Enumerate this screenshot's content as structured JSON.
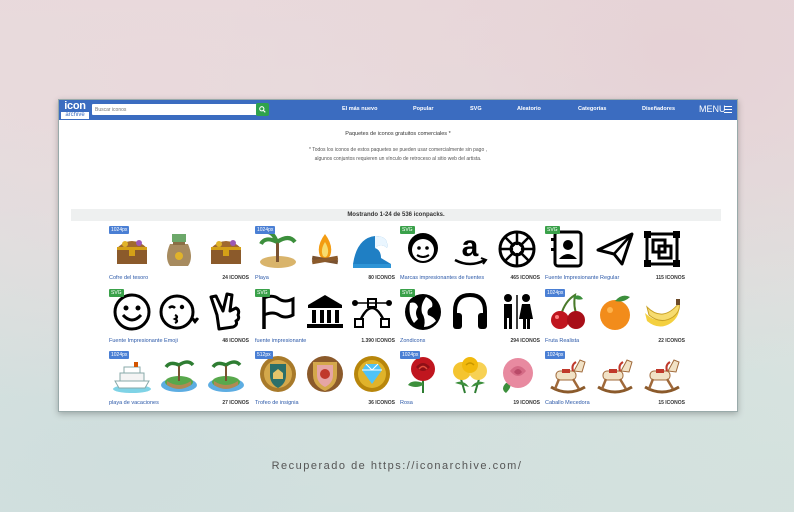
{
  "header": {
    "logo_top": "icon",
    "logo_bottom": "archive",
    "search_placeholder": "Buscar iconos",
    "nav": [
      "El más nuevo",
      "Popular",
      "SVG",
      "Aleatorio",
      "Categorías",
      "Diseñadores"
    ],
    "menu_label": "MENU"
  },
  "intro": {
    "heading": "Paquetes de iconos gratuitos comerciales *",
    "line1": "* Todos los iconos de estos paquetes se pueden usar comercialmente sin pago ,",
    "line2": "algunos conjuntos requieren un vínculo de retroceso al sitio web del artista."
  },
  "showing": "Mostrando 1-24 de 536 iconpacks.",
  "packs": [
    {
      "badge": "1024px",
      "title": "Cofre del tesoro",
      "count": "24 ICONOS",
      "icons": [
        "treasure-chest-icon",
        "money-bag-icon",
        "treasure-chest-icon"
      ],
      "badge_color": "#4a7fd4"
    },
    {
      "badge": "1024px",
      "title": "Playa",
      "count": "80 ICONOS",
      "icons": [
        "palm-island-icon",
        "campfire-icon",
        "wave-icon"
      ],
      "badge_color": "#4a7fd4"
    },
    {
      "badge": "SVG",
      "title": "Marcas impresionantes de fuentes",
      "count": "465 ICONOS",
      "icons": [
        "mailchimp-icon",
        "amazon-icon",
        "galactic-republic-icon"
      ],
      "badge_color": "#3aa14a"
    },
    {
      "badge": "SVG",
      "title": "Fuente Impresionante Regular",
      "count": "115 ICONOS",
      "icons": [
        "address-book-icon",
        "paper-plane-icon",
        "object-group-icon"
      ],
      "badge_color": "#3aa14a"
    },
    {
      "badge": "SVG",
      "title": "Fuente Impresionante Emoji",
      "count": "48 ICONOS",
      "icons": [
        "smile-icon",
        "kiss-icon",
        "victory-hand-icon"
      ],
      "badge_color": "#3aa14a"
    },
    {
      "badge": "SVG",
      "title": "fuente impresionante",
      "count": "1.390 ICONOS",
      "icons": [
        "flag-icon",
        "bank-icon",
        "bezier-curve-icon"
      ],
      "badge_color": "#3aa14a"
    },
    {
      "badge": "SVG",
      "title": "Zondicons",
      "count": "294 ICONOS",
      "icons": [
        "globe-icon",
        "headphones-icon",
        "restroom-icon"
      ],
      "badge_color": "#3aa14a"
    },
    {
      "badge": "1024px",
      "title": "Fruta Realista",
      "count": "22 ICONOS",
      "icons": [
        "cherries-icon",
        "orange-icon",
        "bananas-icon"
      ],
      "badge_color": "#4a7fd4"
    },
    {
      "badge": "1024px",
      "title": "playa de vacaciones",
      "count": "27 ICONOS",
      "icons": [
        "cruise-ship-icon",
        "island-icon",
        "island-icon"
      ],
      "badge_color": "#4a7fd4"
    },
    {
      "badge": "512px",
      "title": "Trofeo de insignia",
      "count": "36 ICONOS",
      "icons": [
        "shield-badge-icon",
        "crest-badge-icon",
        "gem-badge-icon"
      ],
      "badge_color": "#4a7fd4"
    },
    {
      "badge": "1024px",
      "title": "Rosa",
      "count": "19 ICONOS",
      "icons": [
        "red-rose-icon",
        "yellow-roses-icon",
        "pink-rose-icon"
      ],
      "badge_color": "#4a7fd4"
    },
    {
      "badge": "1024px",
      "title": "Caballo Mecedora",
      "count": "15 ICONOS",
      "icons": [
        "rocking-horse-icon",
        "rocking-horse-icon",
        "rocking-horse-icon"
      ],
      "badge_color": "#4a7fd4"
    }
  ],
  "footer": "Recuperado de https://iconarchive.com/",
  "colors": {
    "topbar": "#3b6cc0",
    "search_button": "#2fa24c",
    "link": "#2b58a8"
  }
}
